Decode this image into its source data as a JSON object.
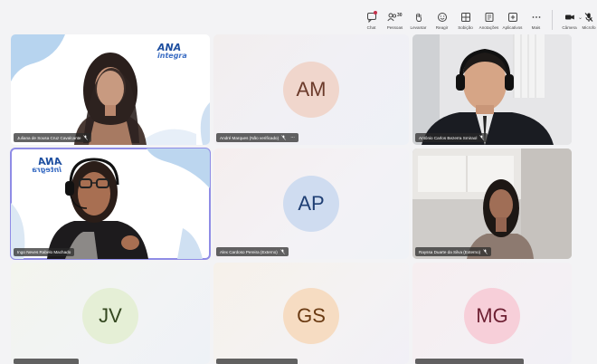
{
  "toolbar": {
    "chat": "Chat",
    "people": "Pessoas",
    "people_count": "30",
    "raise": "Levantar",
    "react": "Reagir",
    "rooms": "Sobição",
    "notes": "Anotações",
    "apps": "Aplicativos",
    "more": "Mais",
    "camera": "Câmera",
    "mic": "Microfo"
  },
  "colors": {
    "active_border": "#8f8ce6",
    "name_bg": "#282828",
    "am_bg": "#f0d6cc",
    "am_fg": "#6b3a2a",
    "ap_bg": "#cfdcf0",
    "ap_fg": "#1f3f74",
    "jv_bg": "#e5efd6",
    "jv_fg": "#33471f",
    "gs_bg": "#f6dcc2",
    "gs_fg": "#6a3a12",
    "mg_bg": "#f7cfd9",
    "mg_fg": "#6d1f32"
  },
  "logo": {
    "top": "ANA",
    "bottom": "integra"
  },
  "tiles": [
    {
      "name": "Juliana de Sousa Cruz Cavalcante"
    },
    {
      "name": "André Marques (Não verificado)",
      "initials": "AM"
    },
    {
      "name": "Antônio Carlos Bezerra Smiraol"
    },
    {
      "name": "Ingo Neves Rabelo Machado"
    },
    {
      "name": "Alex Cardoso Pereira (Externo)",
      "initials": "AP"
    },
    {
      "name": "Rayssa Duarte da Silva (Externo)"
    },
    {
      "name": "",
      "initials": "JV"
    },
    {
      "name": "",
      "initials": "GS"
    },
    {
      "name": "",
      "initials": "MG"
    }
  ]
}
